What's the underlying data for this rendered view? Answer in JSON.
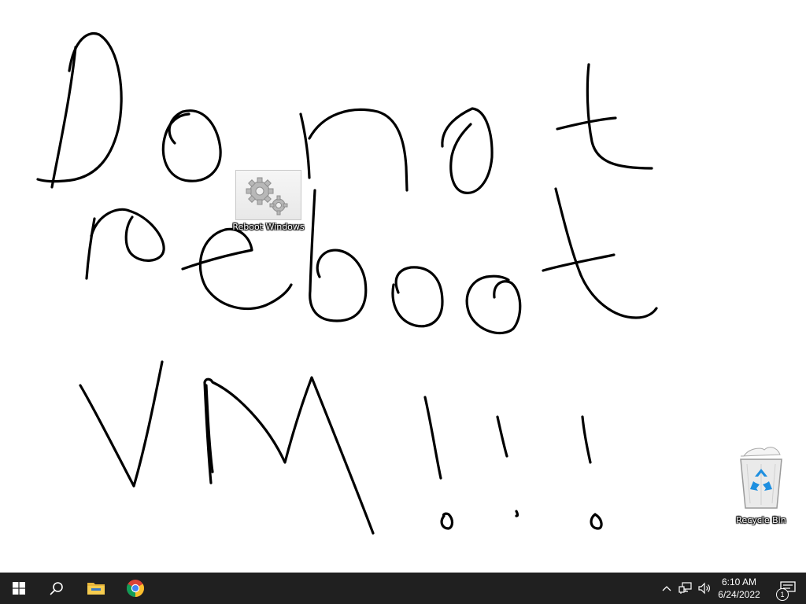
{
  "desktop": {
    "background_color": "#ffffff",
    "ink_color": "#000000",
    "handwriting": "Do not reboot VM!!!",
    "icons": [
      {
        "label": "Reboot Windows",
        "icon": "gears-icon"
      },
      {
        "label": "Recycle Bin",
        "icon": "recycle-bin-icon"
      }
    ]
  },
  "taskbar": {
    "background_color": "#202020",
    "pinned": [
      {
        "name": "start-button",
        "icon": "windows-logo-icon"
      },
      {
        "name": "search-button",
        "icon": "search-icon"
      },
      {
        "name": "file-explorer-button",
        "icon": "folder-icon"
      },
      {
        "name": "chrome-button",
        "icon": "chrome-icon"
      }
    ],
    "tray": {
      "icons": [
        "chevron-up-icon",
        "network-icon",
        "volume-icon"
      ],
      "time": "6:10 AM",
      "date": "6/24/2022",
      "notification_count": "1"
    }
  }
}
